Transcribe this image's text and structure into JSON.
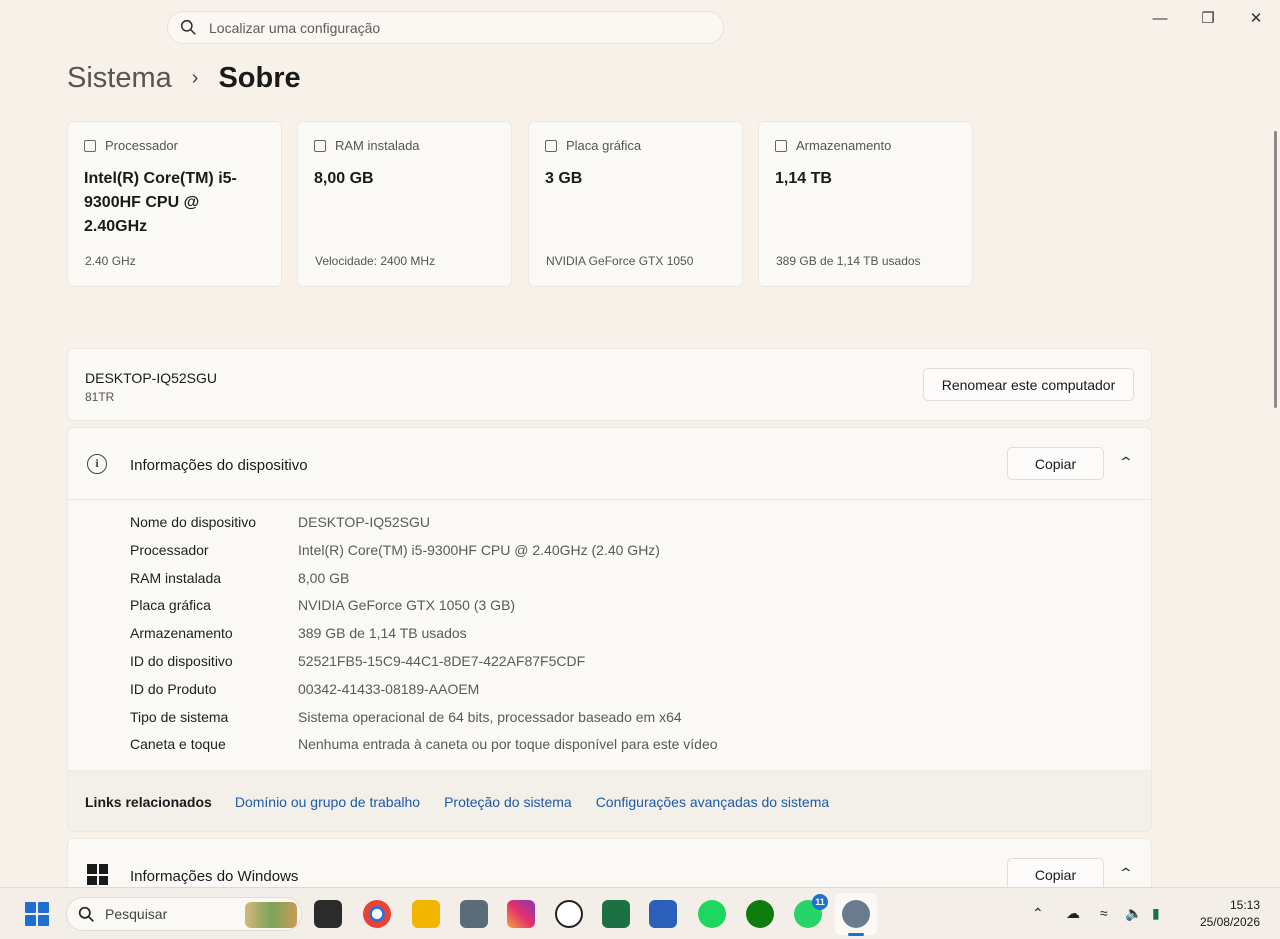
{
  "search": {
    "placeholder": "Localizar uma configuração"
  },
  "breadcrumb": {
    "parent": "Sistema",
    "separator": "›",
    "current": "Sobre"
  },
  "specs": [
    {
      "label": "Processador",
      "value": "Intel(R) Core(TM) i5-9300HF CPU @ 2.40GHz",
      "sub": "2.40 GHz"
    },
    {
      "label": "RAM instalada",
      "value": "8,00 GB",
      "sub": "Velocidade: 2400 MHz"
    },
    {
      "label": "Placa gráfica",
      "value": "3 GB",
      "sub": "NVIDIA GeForce GTX 1050"
    },
    {
      "label": "Armazenamento",
      "value": "1,14 TB",
      "sub": "389 GB de 1,14 TB usados"
    }
  ],
  "computer": {
    "name": "DESKTOP-IQ52SGU",
    "model": "81TR",
    "rename_label": "Renomear este computador"
  },
  "device_info": {
    "title": "Informações do dispositivo",
    "copy_label": "Copiar",
    "rows": [
      {
        "key": "Nome do dispositivo",
        "value": "DESKTOP-IQ52SGU"
      },
      {
        "key": "Processador",
        "value": "Intel(R) Core(TM) i5-9300HF CPU @ 2.40GHz (2.40 GHz)"
      },
      {
        "key": "RAM instalada",
        "value": "8,00 GB"
      },
      {
        "key": "Placa gráfica",
        "value": "NVIDIA GeForce GTX 1050 (3 GB)"
      },
      {
        "key": "Armazenamento",
        "value": "389 GB de 1,14 TB usados"
      },
      {
        "key": "ID do dispositivo",
        "value": "52521FB5-15C9-44C1-8DE7-422AF87F5CDF"
      },
      {
        "key": "ID do Produto",
        "value": "00342-41433-08189-AAOEM"
      },
      {
        "key": "Tipo de sistema",
        "value": "Sistema operacional de 64 bits, processador baseado em x64"
      },
      {
        "key": "Caneta e toque",
        "value": "Nenhuma entrada à caneta ou por toque disponível para este vídeo"
      }
    ]
  },
  "related_links": {
    "label": "Links relacionados",
    "links": [
      "Domínio ou grupo de trabalho",
      "Proteção do sistema",
      "Configurações avançadas do sistema"
    ]
  },
  "windows_info": {
    "title": "Informações do Windows",
    "copy_label": "Copiar"
  },
  "taskbar": {
    "search_label": "Pesquisar",
    "whatsapp_badge": "11",
    "time": "15:13",
    "date": "25/08/2026"
  },
  "colors": {
    "accent": "#1f6fd0",
    "link": "#1d5aa8",
    "background": "#f7f1ea"
  }
}
